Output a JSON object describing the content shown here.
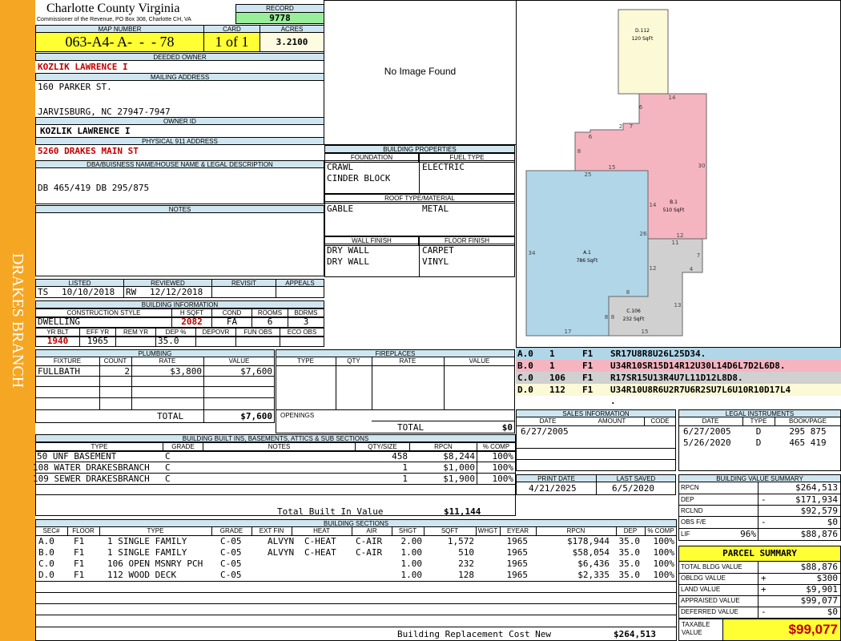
{
  "county": {
    "name": "Charlotte County Virginia",
    "address": "Commissioner of the Revenue, PO Box 308, Charlotte CH, VA"
  },
  "sidebar": "DRAKES BRANCH",
  "record": {
    "label": "RECORD",
    "value": "9778"
  },
  "map": {
    "label": "MAP NUMBER",
    "value": "063-A4- A-  -  - 78"
  },
  "card": {
    "label": "CARD",
    "value": "1 of 1"
  },
  "acres": {
    "label": "ACRES",
    "value": "3.2100"
  },
  "owner": {
    "deeded_label": "DEEDED OWNER",
    "name": "KOZLIK LAWRENCE I",
    "mail_label": "MAILING ADDRESS",
    "addr1": "160 PARKER ST.",
    "addr2": "JARVISBURG, NC 27947-7947",
    "id_label": "OWNER ID",
    "id": "KOZLIK LAWRENCE I",
    "phys_label": "PHYSICAL 911 ADDRESS",
    "phys": "5260 DRAKES MAIN ST"
  },
  "dba": {
    "label": "DBA/BUISNESS NAME/HOUSE NAME & LEGAL DESCRIPTION",
    "value": "DB 465/419 DB 295/875"
  },
  "notes": {
    "label": "NOTES"
  },
  "photo": {
    "text": "No Image Found"
  },
  "dates": {
    "listed_label": "LISTED",
    "listed_code": "TS",
    "listed": "10/10/2018",
    "reviewed_label": "REVIEWED",
    "reviewed_code": "RW",
    "reviewed": "12/12/2018",
    "revisit_label": "REVISIT",
    "appeals_label": "APPEALS"
  },
  "binfo": {
    "label": "BUILDING INFORMATION",
    "cs_label": "CONSTRUCTION STYLE",
    "hsqft_label": "H SQFT",
    "cond_label": "COND",
    "rooms_label": "ROOMS",
    "bdrms_label": "BDRMS",
    "style": "DWELLING",
    "hsqft": "2082",
    "cond": "FA",
    "rooms": "6",
    "bdrms": "3",
    "yb_label": "YR BLT",
    "eff_label": "EFF YR",
    "rem_label": "REM YR",
    "dep_label": "DEP %",
    "depovr_label": "DEPOVR",
    "fun_label": "FUN OBS",
    "eco_label": "ECO OBS",
    "yb": "1940",
    "eff": "1965",
    "dep": "35.0"
  },
  "bprops": {
    "label": "BUILDING PROPERTIES",
    "found_label": "FOUNDATION",
    "fuel_label": "FUEL TYPE",
    "found1": "CRAWL",
    "found2": "CINDER BLOCK",
    "fuel": "ELECTRIC",
    "roof_label": "ROOF TYPE/MATERIAL",
    "roof1": "GABLE",
    "roof2": "METAL",
    "wall_label": "WALL FINISH",
    "floor_label": "FLOOR FINISH",
    "wall1": "DRY WALL",
    "wall2": "DRY WALL",
    "floor1": "CARPET",
    "floor2": "VINYL"
  },
  "sketch": {
    "labels": [
      {
        "id": "D.112",
        "sq": "120 SqFt"
      },
      {
        "id": "B.1",
        "sq": "510 SqFt"
      },
      {
        "id": "A.1",
        "sq": "786 SqFt"
      },
      {
        "id": "C.106",
        "sq": "232 SqFt"
      }
    ],
    "dims": [
      "14",
      "6",
      "7",
      "2",
      "6",
      "8",
      "15",
      "30",
      "25",
      "14",
      "26",
      "12",
      "11",
      "7",
      "4",
      "12",
      "34",
      "13",
      "8",
      "8",
      "8",
      "17",
      "15"
    ],
    "colors": {
      "a": "#b0d6e8",
      "b": "#f5b5c0",
      "c": "#d0d0d0",
      "d": "#fbf9d6"
    }
  },
  "segments": [
    {
      "sec": "A.0",
      "n": "1",
      "f": "F1",
      "desc": "SR17U8R8U26L25D34.",
      "color": "#b0d6e8"
    },
    {
      "sec": "B.0",
      "n": "1",
      "f": "F1",
      "desc": "U34R10SR15D14R12U30L14D6L7D2L6D8.",
      "color": "#f5b5c0"
    },
    {
      "sec": "C.0",
      "n": "106",
      "f": "F1",
      "desc": "R17SR15U13R4U7L11D12L8D8.",
      "color": "#d0d0d0"
    },
    {
      "sec": "D.0",
      "n": "112",
      "f": "F1",
      "desc": "U34R10U8R6U2R7U6R2SU7L6U10R10D17L4",
      "color": "#fbf9d6"
    }
  ],
  "segments_tail": ".",
  "plumbing": {
    "label": "PLUMBING",
    "cols": [
      "FIXTURE",
      "COUNT",
      "RATE",
      "VALUE"
    ],
    "rows": [
      [
        "FULLBATH",
        "2",
        "$3,800",
        "$7,600"
      ]
    ],
    "total_label": "TOTAL",
    "total": "$7,600"
  },
  "fireplaces": {
    "label": "FIREPLACES",
    "cols": [
      "TYPE",
      "QTY",
      "RATE",
      "VALUE"
    ],
    "openings_label": "OPENINGS",
    "total_label": "TOTAL",
    "total": "$0"
  },
  "sales": {
    "label": "SALES INFORMATION",
    "cols": [
      "DATE",
      "AMOUNT",
      "CODE"
    ],
    "rows": [
      [
        "6/27/2005",
        "",
        ""
      ]
    ]
  },
  "legal": {
    "label": "LEGAL INSTRUMENTS",
    "cols": [
      "DATE",
      "TYPE",
      "BOOK/PAGE"
    ],
    "rows": [
      [
        "6/27/2005",
        "D",
        "295 875"
      ],
      [
        "5/26/2020",
        "D",
        "465 419"
      ]
    ]
  },
  "print": {
    "label": "PRINT DATE",
    "value": "4/21/2025",
    "saved_label": "LAST SAVED",
    "saved": "6/5/2020"
  },
  "builtins": {
    "label": "BUILDING BUILT INS, BASEMENTS, ATTICS & SUB SECTIONS",
    "cols": [
      "TYPE",
      "GRADE",
      "NOTES",
      "QTY/SIZE",
      "RPCN",
      "% COMP"
    ],
    "rows": [
      [
        "50 UNF BASEMENT",
        "C",
        "",
        "458",
        "$8,244",
        "100%"
      ],
      [
        "108 WATER DRAKESBRANCH",
        "C",
        "",
        "1",
        "$1,000",
        "100%"
      ],
      [
        "109 SEWER DRAKESBRANCH",
        "C",
        "",
        "1",
        "$1,900",
        "100%"
      ]
    ],
    "total_label": "Total Built In Value",
    "total": "$11,144"
  },
  "sections": {
    "label": "BUILDING SECTIONS",
    "cols": [
      "SEC#",
      "FLOOR",
      "TYPE",
      "GRADE",
      "EXT FIN",
      "HEAT",
      "AIR",
      "SHGT",
      "SQFT",
      "WHGT",
      "EYEAR",
      "RPCN",
      "DEP",
      "% COMP"
    ],
    "rows": [
      [
        "A.0",
        "F1",
        "1 SINGLE FAMILY",
        "C-05",
        "ALVYN",
        "C-HEAT",
        "C-AIR",
        "2.00",
        "1,572",
        "",
        "1965",
        "$178,944",
        "35.0",
        "100%"
      ],
      [
        "B.0",
        "F1",
        "1 SINGLE FAMILY",
        "C-05",
        "ALVYN",
        "C-HEAT",
        "C-AIR",
        "1.00",
        "510",
        "",
        "1965",
        "$58,054",
        "35.0",
        "100%"
      ],
      [
        "C.0",
        "F1",
        "106 OPEN MSNRY PCH",
        "C-05",
        "",
        "",
        "",
        "1.00",
        "232",
        "",
        "1965",
        "$6,436",
        "35.0",
        "100%"
      ],
      [
        "D.0",
        "F1",
        "112 WOOD DECK",
        "C-05",
        "",
        "",
        "",
        "1.00",
        "128",
        "",
        "1965",
        "$2,335",
        "35.0",
        "100%"
      ]
    ],
    "total_label": "Building Replacement Cost New",
    "total": "$264,513"
  },
  "bvs": {
    "label": "BUILDING VALUE SUMMARY",
    "rows": [
      {
        "k": "RPCN",
        "s": "",
        "v": "$264,513"
      },
      {
        "k": "DEP",
        "s": "-",
        "v": "$171,934"
      },
      {
        "k": "RCLND",
        "s": "",
        "v": "$92,579"
      },
      {
        "k": "OBS F/E",
        "s": "-",
        "v": "$0"
      },
      {
        "k": "LIF",
        "s": "96%",
        "v": "$88,876"
      }
    ]
  },
  "parcel": {
    "label": "PARCEL SUMMARY",
    "rows": [
      {
        "k": "TOTAL BLDG VALUE",
        "s": "",
        "v": "$88,876"
      },
      {
        "k": "OBLDG VALUE",
        "s": "+",
        "v": "$300"
      },
      {
        "k": "LAND VALUE",
        "s": "+",
        "v": "$9,901"
      },
      {
        "k": "APPRAISED VALUE",
        "s": "",
        "v": "$99,077"
      },
      {
        "k": "DEFERRED VALUE",
        "s": "-",
        "v": "$0"
      }
    ],
    "taxable_label": "TAXABLE VALUE",
    "taxable": "$99,077"
  }
}
